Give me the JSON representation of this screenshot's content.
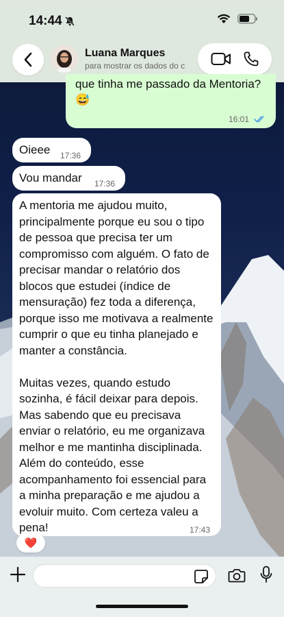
{
  "status_bar": {
    "time": "14:44",
    "icons": [
      "bell-slash-icon",
      "wifi-icon",
      "battery-icon"
    ]
  },
  "header": {
    "contact_name": "Luana Marques",
    "contact_subtitle": "para mostrar os dados do c",
    "icons": [
      "chevron-left-icon",
      "video-camera-icon",
      "phone-icon"
    ]
  },
  "messages": [
    {
      "direction": "outgoing",
      "text": "pode me reenviar aquele feedback que tinha me passado da Mentoria? 😅",
      "time": "16:01",
      "status": "read"
    },
    {
      "direction": "incoming",
      "text": "Oieee",
      "time": "17:36"
    },
    {
      "direction": "incoming",
      "text": "Vou mandar",
      "time": "17:36"
    },
    {
      "direction": "incoming",
      "paragraph1": "A mentoria me ajudou muito, principalmente porque eu sou o tipo de pessoa que precisa ter um compromisso com alguém. O fato de precisar mandar o relatório dos blocos que estudei  (índice  de mensuração) fez toda a diferença, porque isso me motivava a realmente cumprir o que eu tinha planejado e manter a constância.",
      "paragraph2": "Muitas vezes, quando estudo sozinha, é fácil deixar para depois. Mas sabendo que eu precisava enviar o relatório, eu me organizava melhor e me mantinha disciplinada. Além do conteúdo, esse acompanhamento foi essencial para a minha preparação e me ajudou a evoluir muito. Com certeza valeu a pena!",
      "time": "17:43",
      "reaction": "❤️"
    }
  ],
  "composer": {
    "placeholder": "",
    "icons": [
      "plus-icon",
      "sticker-icon",
      "camera-icon",
      "microphone-icon"
    ]
  },
  "colors": {
    "outgoing_bubble": "#d9fdd3",
    "incoming_bubble": "#ffffff",
    "read_ticks": "#4fa3e0"
  }
}
